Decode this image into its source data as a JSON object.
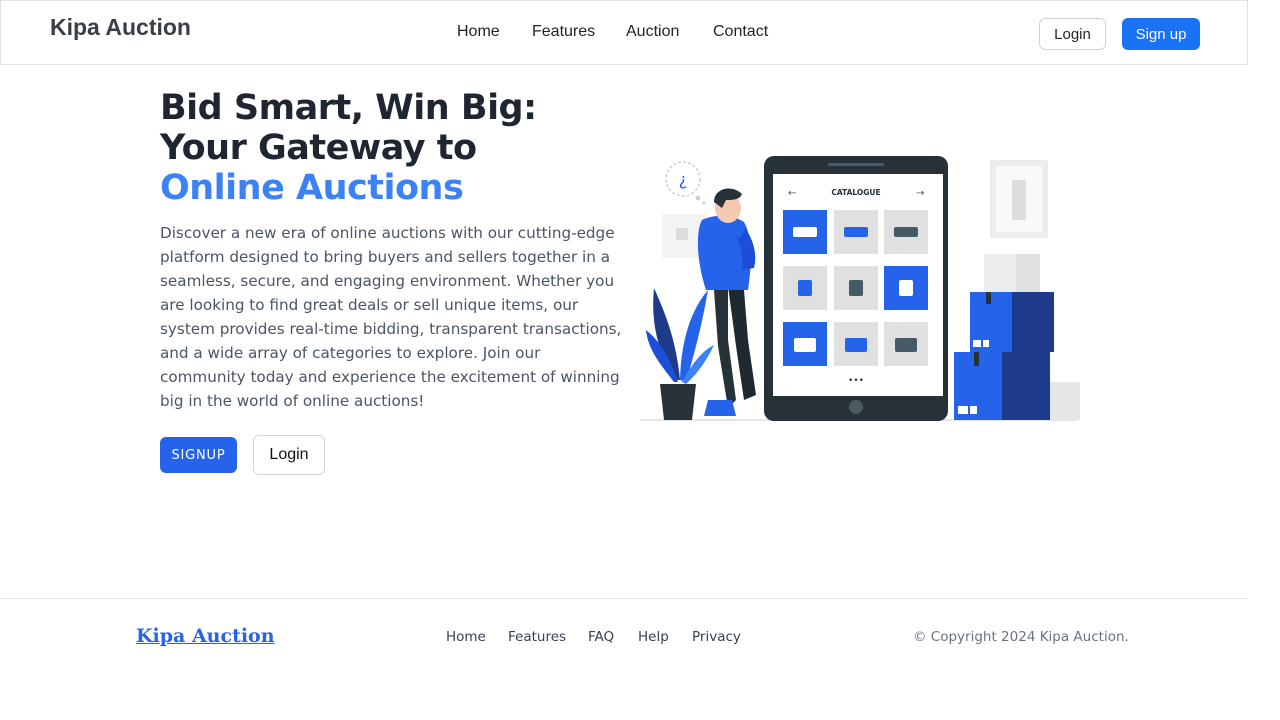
{
  "header": {
    "brand": "Kipa Auction",
    "nav": [
      "Home",
      "Features",
      "Auction",
      "Contact"
    ],
    "login_label": "Login",
    "signup_label": "Sign up"
  },
  "hero": {
    "title_line1": "Bid Smart, Win Big:",
    "title_line2": "Your Gateway to",
    "title_line3": "Online Auctions",
    "description": "Discover a new era of online auctions with our cutting-edge platform designed to bring buyers and sellers together in a seamless, secure, and engaging environment. Whether you are looking to find great deals or sell unique items, our system provides real-time bidding, transparent transactions, and a wide array of categories to explore. Join our community today and experience the excitement of winning big in the world of online auctions!",
    "signup_label": "SIGNUP",
    "login_label": "Login"
  },
  "illustration": {
    "catalogue_label": "CATALOGUE",
    "thought_glyph": "¿",
    "dots": "•••"
  },
  "footer": {
    "brand": "Kipa Auction",
    "links": [
      "Home",
      "Features",
      "FAQ",
      "Help",
      "Privacy"
    ],
    "copyright": "© Copyright 2024 Kipa Auction."
  },
  "colors": {
    "primary": "#1a73f4",
    "accent_text": "#3b82f6",
    "button_blue": "#2563eb",
    "illustration_blue": "#2563eb",
    "illustration_dark": "#263238"
  }
}
